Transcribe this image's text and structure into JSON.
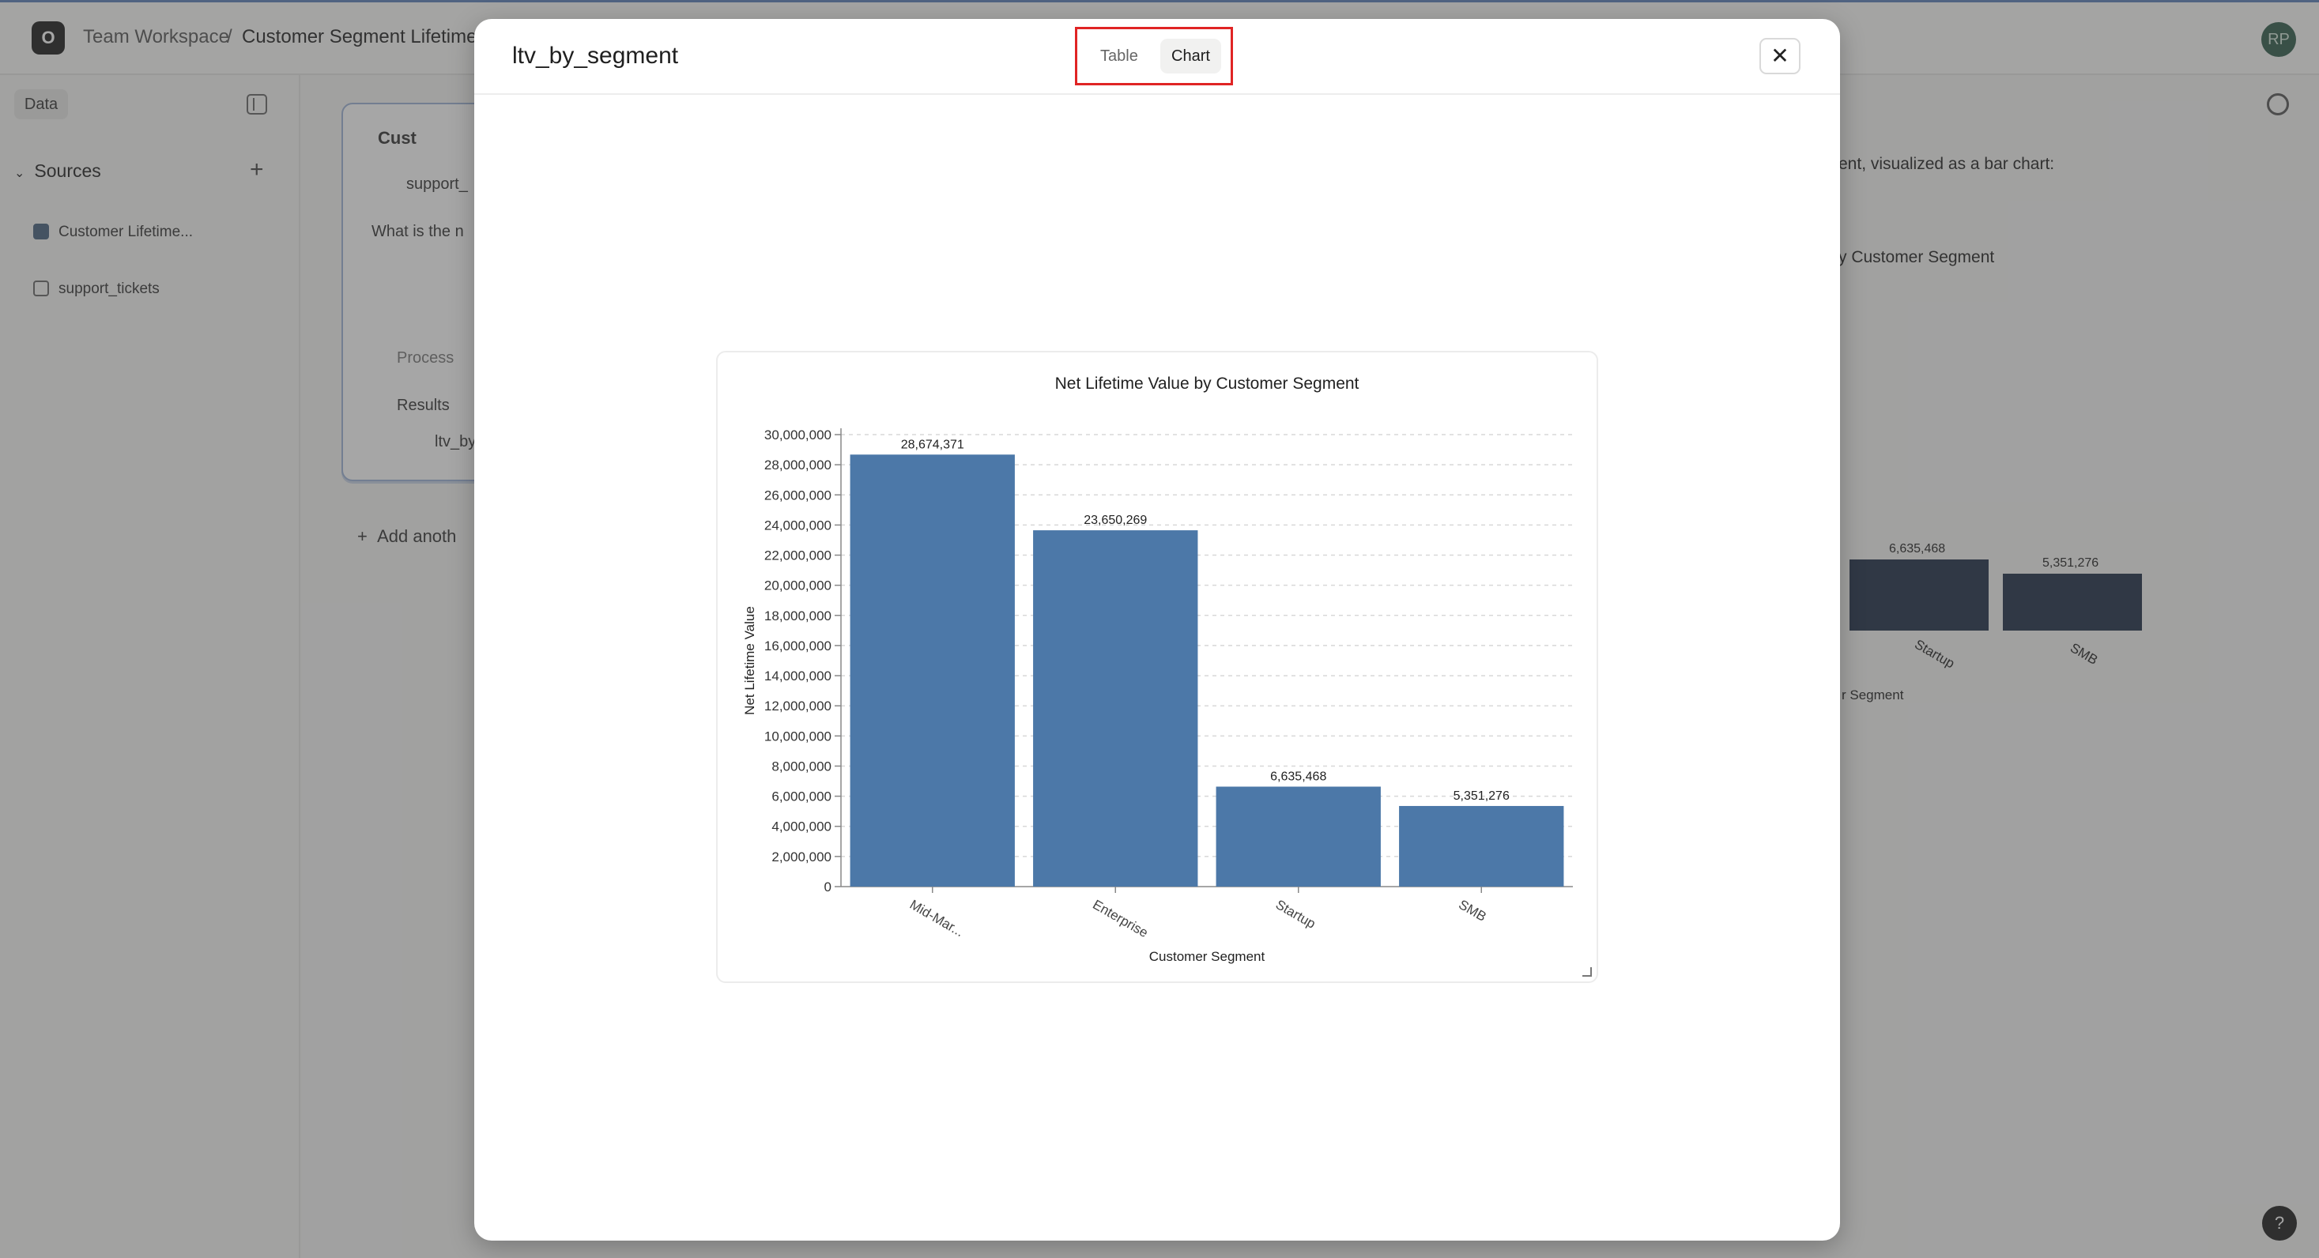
{
  "topbar": {
    "logo": "O",
    "workspace": "Team Workspace",
    "separator": "/",
    "page": "Customer Segment Lifetime",
    "avatar": "RP"
  },
  "sidebar": {
    "data_tab": "Data",
    "sources_label": "Sources",
    "items": [
      {
        "label": "Customer Lifetime..."
      },
      {
        "label": "support_tickets"
      }
    ]
  },
  "card": {
    "title": "Cust",
    "source_chip": "support_",
    "question": "What is the n",
    "process_label": "Process",
    "results_label": "Results",
    "result_item": "ltv_by"
  },
  "add_another": "Add anoth",
  "right_panel": {
    "text1": "ent, visualized as a bar chart:",
    "text2": "y Customer Segment",
    "val_startup": "6,635,468",
    "val_smb": "5,351,276",
    "lbl_startup": "Startup",
    "lbl_smb": "SMB",
    "axis_frag": "r Segment"
  },
  "modal": {
    "title": "ltv_by_segment",
    "tabs": [
      "Table",
      "Chart"
    ],
    "active_tab": "Chart",
    "close_symbol": "✕"
  },
  "chart_data": {
    "type": "bar",
    "title": "Net Lifetime Value by Customer Segment",
    "xlabel": "Customer Segment",
    "ylabel": "Net Lifetime Value",
    "categories": [
      "Mid-Mar...",
      "Enterprise",
      "Startup",
      "SMB"
    ],
    "values": [
      28674371,
      23650269,
      6635468,
      5351276
    ],
    "value_labels": [
      "28,674,371",
      "23,650,269",
      "6,635,468",
      "5,351,276"
    ],
    "ylim": [
      0,
      30000000
    ],
    "yticks": [
      "0",
      "2,000,000",
      "4,000,000",
      "6,000,000",
      "8,000,000",
      "10,000,000",
      "12,000,000",
      "14,000,000",
      "16,000,000",
      "18,000,000",
      "20,000,000",
      "22,000,000",
      "24,000,000",
      "26,000,000",
      "28,000,000",
      "30,000,000"
    ],
    "bar_color": "#4c78a8",
    "grid": true
  },
  "help_symbol": "?"
}
